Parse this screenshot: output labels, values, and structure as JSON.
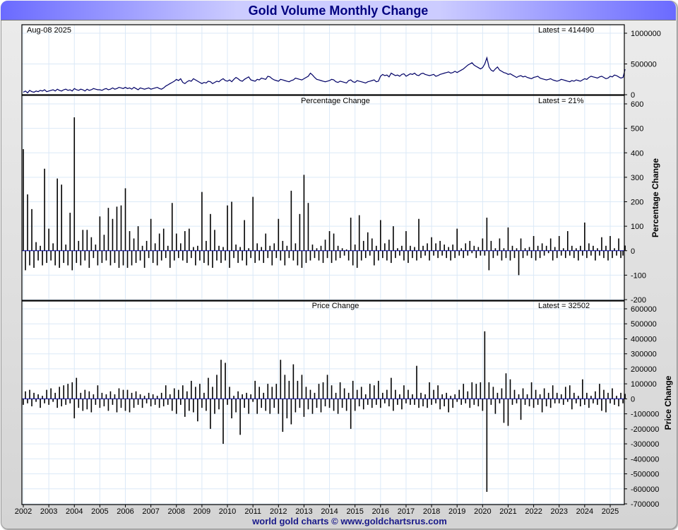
{
  "title": "Gold Volume Monthly Change",
  "footer": "world gold charts © www.goldchartsrus.com",
  "chart_data": [
    {
      "type": "line",
      "name": "volume",
      "date_label": "Aug-08  2025",
      "latest_label": "Latest = 414490",
      "ylim": [
        0,
        1000000
      ],
      "yticks": [
        0,
        500000,
        1000000
      ],
      "ytick_labels": [
        "0",
        "500000",
        "1000000"
      ],
      "color": "#000066",
      "start": "2002-01",
      "values_thousands": [
        40,
        60,
        30,
        70,
        50,
        40,
        60,
        50,
        70,
        60,
        80,
        50,
        60,
        70,
        80,
        60,
        90,
        70,
        60,
        80,
        90,
        70,
        80,
        60,
        100,
        80,
        70,
        90,
        80,
        60,
        90,
        70,
        80,
        100,
        90,
        80,
        80,
        70,
        90,
        100,
        80,
        90,
        110,
        90,
        100,
        120,
        110,
        100,
        120,
        100,
        110,
        90,
        120,
        100,
        80,
        110,
        100,
        90,
        100,
        110,
        90,
        100,
        110,
        120,
        100,
        90,
        110,
        140,
        160,
        180,
        200,
        220,
        250,
        230,
        260,
        200,
        180,
        210,
        230,
        220,
        260,
        240,
        220,
        200,
        180,
        200,
        190,
        220,
        210,
        180,
        200,
        220,
        210,
        240,
        260,
        230,
        220,
        240,
        210,
        250,
        280,
        260,
        230,
        220,
        250,
        270,
        290,
        240,
        230,
        220,
        250,
        240,
        270,
        260,
        250,
        300,
        290,
        260,
        240,
        230,
        220,
        250,
        240,
        230,
        220,
        210,
        230,
        240,
        270,
        260,
        250,
        240,
        260,
        280,
        300,
        350,
        320,
        280,
        250,
        240,
        230,
        220,
        210,
        220,
        230,
        250,
        240,
        210,
        200,
        220,
        210,
        200,
        190,
        230,
        240,
        210,
        200,
        230,
        220,
        210,
        200,
        190,
        210,
        220,
        230,
        240,
        210,
        220,
        300,
        330,
        310,
        320,
        290,
        350,
        330,
        310,
        320,
        300,
        330,
        340,
        300,
        320,
        340,
        330,
        350,
        320,
        310,
        340,
        350,
        330,
        320,
        310,
        320,
        330,
        300,
        310,
        330,
        340,
        350,
        360,
        370,
        350,
        360,
        380,
        360,
        380,
        400,
        420,
        450,
        480,
        500,
        520,
        480,
        460,
        440,
        420,
        440,
        500,
        600,
        450,
        400,
        380,
        420,
        450,
        400,
        380,
        360,
        350,
        330,
        340,
        320,
        300,
        280,
        300,
        310,
        290,
        300,
        280,
        270,
        260,
        280,
        290,
        300,
        270,
        260,
        250,
        240,
        250,
        260,
        240,
        230,
        220,
        230,
        250,
        240,
        230,
        220,
        210,
        230,
        220,
        240,
        230,
        220,
        240,
        260,
        250,
        280,
        300,
        290,
        280,
        270,
        290,
        300,
        280,
        260,
        270,
        300,
        290,
        320,
        310,
        290,
        270,
        280,
        414
      ]
    },
    {
      "type": "bar",
      "name": "percentage",
      "title": "Percentage Change",
      "latest_label": "Latest = 21%",
      "ylabel": "Percentage Change",
      "ylim": [
        -200,
        600
      ],
      "yticks": [
        -200,
        -100,
        0,
        100,
        200,
        300,
        400,
        500,
        600
      ],
      "ytick_labels": [
        "-200",
        "-100",
        "0",
        "100",
        "200",
        "300",
        "400",
        "500",
        "600"
      ],
      "start": "2002-01",
      "values": [
        415,
        -80,
        230,
        -60,
        170,
        -70,
        35,
        -40,
        20,
        -60,
        335,
        -50,
        90,
        -40,
        30,
        -60,
        295,
        -70,
        270,
        -50,
        25,
        -60,
        155,
        -80,
        545,
        -50,
        40,
        -60,
        85,
        -40,
        85,
        -70,
        55,
        -30,
        25,
        -60,
        140,
        -50,
        65,
        -40,
        175,
        -60,
        130,
        -50,
        180,
        -70,
        185,
        -60,
        255,
        -70,
        80,
        -60,
        50,
        -50,
        100,
        -40,
        20,
        -70,
        40,
        -30,
        130,
        -50,
        30,
        -60,
        70,
        -40,
        90,
        -30,
        20,
        -70,
        195,
        -40,
        70,
        -30,
        30,
        -40,
        80,
        -50,
        90,
        -30,
        15,
        -60,
        20,
        -40,
        240,
        -50,
        40,
        -60,
        150,
        -70,
        85,
        -40,
        20,
        -50,
        15,
        -40,
        185,
        -70,
        200,
        -30,
        25,
        -50,
        15,
        -40,
        125,
        -60,
        10,
        -30,
        220,
        -50,
        30,
        -40,
        15,
        -50,
        70,
        -30,
        20,
        -60,
        30,
        -30,
        130,
        -40,
        40,
        -60,
        20,
        -30,
        245,
        -40,
        30,
        -60,
        150,
        -70,
        310,
        -50,
        195,
        -40,
        25,
        -30,
        10,
        -40,
        20,
        -50,
        45,
        -30,
        80,
        -50,
        70,
        -40,
        20,
        -30,
        10,
        -20,
        5,
        -40,
        135,
        -60,
        25,
        -70,
        145,
        -40,
        40,
        -30,
        75,
        -20,
        50,
        -60,
        20,
        -40,
        125,
        -30,
        30,
        -40,
        45,
        -50,
        100,
        -30,
        10,
        -20,
        20,
        -40,
        80,
        -50,
        20,
        -30,
        15,
        -40,
        130,
        -30,
        20,
        -20,
        30,
        -40,
        55,
        -20,
        30,
        -30,
        40,
        -20,
        25,
        -30,
        15,
        -40,
        25,
        -30,
        90,
        -20,
        10,
        -30,
        30,
        -20,
        40,
        -10,
        20,
        -30,
        15,
        -20,
        50,
        -20,
        135,
        -80,
        40,
        -30,
        10,
        -20,
        50,
        -40,
        10,
        -30,
        95,
        -40,
        20,
        -30,
        10,
        -100,
        50,
        -30,
        10,
        -20,
        15,
        -30,
        60,
        -40,
        20,
        -30,
        30,
        -20,
        20,
        -10,
        50,
        -40,
        15,
        -30,
        60,
        -20,
        10,
        -30,
        80,
        -20,
        20,
        -30,
        10,
        -40,
        20,
        -20,
        115,
        -30,
        30,
        -20,
        20,
        -40,
        10,
        -20,
        55,
        -30,
        20,
        -40,
        60,
        -30,
        10,
        -20,
        50,
        -30,
        -20,
        21
      ]
    },
    {
      "type": "bar",
      "name": "price",
      "title": "Price Change",
      "latest_label": "Latest = 32502",
      "ylabel": "Price Change",
      "ylim": [
        -700000,
        600000
      ],
      "yticks": [
        -700000,
        -600000,
        -500000,
        -400000,
        -300000,
        -200000,
        -100000,
        0,
        100000,
        200000,
        300000,
        400000,
        500000,
        600000
      ],
      "ytick_labels": [
        "-700000",
        "-600000",
        "-500000",
        "-400000",
        "-300000",
        "-200000",
        "-100000",
        "0",
        "100000",
        "200000",
        "300000",
        "400000",
        "500000",
        "600000"
      ],
      "start": "2002-01",
      "values_thousands": [
        -40,
        50,
        -30,
        60,
        -50,
        40,
        -20,
        30,
        -60,
        20,
        -30,
        60,
        -40,
        70,
        -20,
        40,
        -60,
        80,
        -50,
        90,
        -40,
        100,
        -30,
        110,
        -130,
        140,
        -60,
        40,
        -80,
        60,
        -70,
        50,
        -90,
        30,
        -40,
        90,
        -60,
        40,
        -50,
        30,
        -80,
        50,
        -40,
        30,
        -90,
        70,
        -60,
        60,
        -80,
        60,
        -90,
        40,
        -60,
        50,
        -40,
        30,
        -60,
        20,
        -30,
        40,
        -50,
        30,
        -40,
        20,
        -60,
        40,
        -50,
        90,
        -40,
        30,
        -80,
        70,
        -100,
        60,
        -40,
        90,
        -120,
        50,
        -80,
        120,
        -90,
        80,
        -150,
        100,
        -60,
        40,
        -80,
        140,
        -200,
        80,
        -100,
        160,
        -70,
        260,
        -300,
        240,
        -40,
        80,
        -130,
        20,
        -90,
        50,
        -240,
        30,
        -60,
        40,
        -100,
        30,
        -20,
        120,
        -100,
        80,
        -60,
        40,
        -80,
        100,
        -100,
        80,
        -60,
        100,
        -100,
        260,
        -220,
        160,
        -130,
        120,
        -170,
        230,
        -90,
        120,
        -60,
        160,
        -120,
        80,
        -70,
        60,
        -100,
        40,
        -60,
        100,
        -90,
        110,
        -50,
        160,
        -60,
        90,
        -80,
        40,
        -100,
        110,
        -60,
        70,
        -80,
        40,
        -200,
        120,
        -80,
        60,
        -50,
        80,
        -70,
        30,
        -40,
        100,
        -60,
        90,
        -40,
        120,
        -60,
        40,
        -30,
        60,
        -50,
        140,
        -80,
        60,
        -40,
        30,
        -70,
        90,
        -30,
        60,
        -40,
        30,
        -40,
        220,
        -60,
        40,
        -50,
        30,
        -60,
        110,
        -40,
        60,
        -30,
        90,
        -70,
        30,
        -50,
        40,
        -90,
        20,
        -60,
        30,
        -20,
        60,
        -40,
        100,
        -30,
        50,
        -60,
        110,
        -40,
        100,
        -50,
        110,
        -80,
        450,
        -620,
        110,
        -40,
        80,
        -100,
        40,
        -30,
        70,
        -160,
        170,
        -180,
        130,
        -40,
        60,
        -30,
        30,
        -140,
        70,
        -40,
        30,
        -50,
        110,
        -60,
        60,
        -40,
        30,
        -90,
        70,
        -50,
        40,
        -60,
        90,
        -30,
        40,
        -30,
        30,
        -40,
        80,
        -20,
        90,
        -70,
        40,
        -30,
        20,
        -50,
        130,
        -40,
        40,
        -60,
        20,
        -30,
        50,
        -40,
        100,
        -80,
        60,
        -90,
        40,
        -30,
        70,
        -40,
        20,
        -50,
        40,
        -30,
        33
      ]
    }
  ],
  "xaxis": {
    "tick_labels": [
      "2002",
      "2003",
      "2004",
      "2005",
      "2006",
      "2007",
      "2008",
      "2009",
      "2010",
      "2011",
      "2012",
      "2013",
      "2014",
      "2015",
      "2016",
      "2017",
      "2018",
      "2019",
      "2020",
      "2021",
      "2022",
      "2023",
      "2024",
      "2025"
    ]
  }
}
